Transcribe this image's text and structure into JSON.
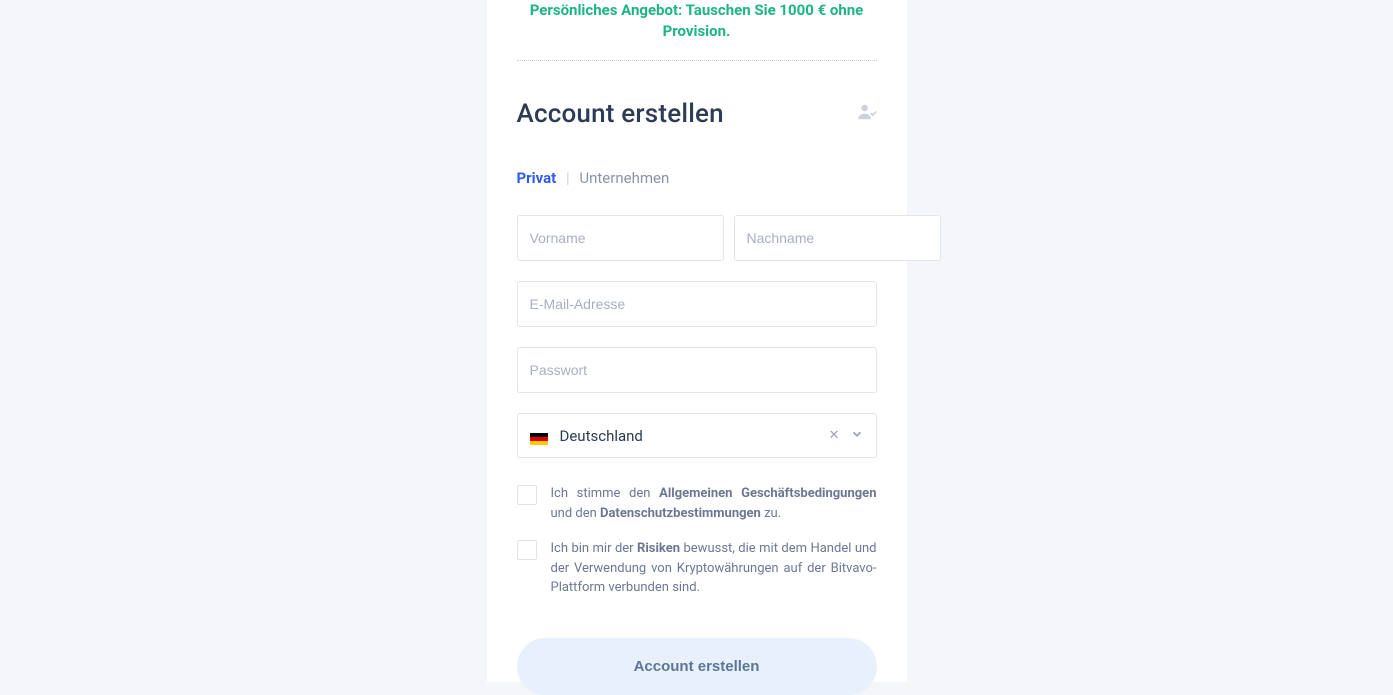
{
  "promo": "Persönliches Angebot: Tauschen Sie 1000 € ohne Provision.",
  "title": "Account erstellen",
  "tabs": {
    "private": "Privat",
    "sep": "|",
    "business": "Unternehmen"
  },
  "placeholders": {
    "first_name": "Vorname",
    "last_name": "Nachname",
    "email": "E-Mail-Adresse",
    "password": "Passwort"
  },
  "country": {
    "name": "Deutschland"
  },
  "consent_terms": {
    "prefix": "Ich stimme den ",
    "link_terms": "Allgemeinen Geschäftsbedingungen",
    "mid": " und den ",
    "link_privacy": "Datenschutzbestimmungen",
    "suffix": " zu."
  },
  "consent_risks": {
    "prefix": "Ich bin mir der ",
    "link": "Risiken",
    "suffix": " bewusst, die mit dem Handel und der Verwendung von Kryptowährungen auf der Bitvavo-Plattform verbunden sind."
  },
  "submit": "Account erstellen"
}
